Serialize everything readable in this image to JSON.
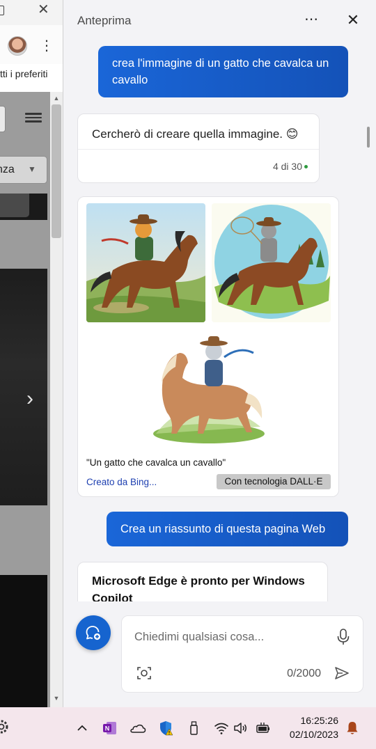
{
  "browser": {
    "favorites_bar_text": "tti i preferiti",
    "select_text": "nza",
    "next_glyph": "›"
  },
  "pane": {
    "title": "Anteprima",
    "more_icon": "more-horizontal-icon",
    "close_icon": "close-icon"
  },
  "conversation": {
    "user_message_1": "crea l'immagine di un gatto che cavalca un cavallo",
    "bot_reply": "Cercherò di creare quella immagine. 😊",
    "turn_counter": "4 di 30",
    "images_caption": "\"Un gatto che cavalca un cavallo\"",
    "images_creator": "Creato da Bing...",
    "images_badge": "Con tecnologia DALL·E",
    "user_message_2": "Crea un riassunto di questa pagina Web",
    "summary_title": "Microsoft Edge è pronto per Windows Copilot"
  },
  "composer": {
    "placeholder": "Chiedimi qualsiasi cosa...",
    "value": "",
    "char_count": "0/2000"
  },
  "taskbar": {
    "time": "16:25:26",
    "date": "02/10/2023",
    "icons": [
      "settings-icon",
      "chevron-up-icon",
      "onenote-icon",
      "onedrive-icon",
      "defender-icon",
      "usb-icon",
      "wifi-icon",
      "volume-icon",
      "battery-icon",
      "notification-bell-icon"
    ]
  },
  "colors": {
    "accent": "#1664cf",
    "user_bubble": "#1a5fcf",
    "pane_bg": "#f3f3f6",
    "taskbar_bg": "#f4e6ec"
  }
}
